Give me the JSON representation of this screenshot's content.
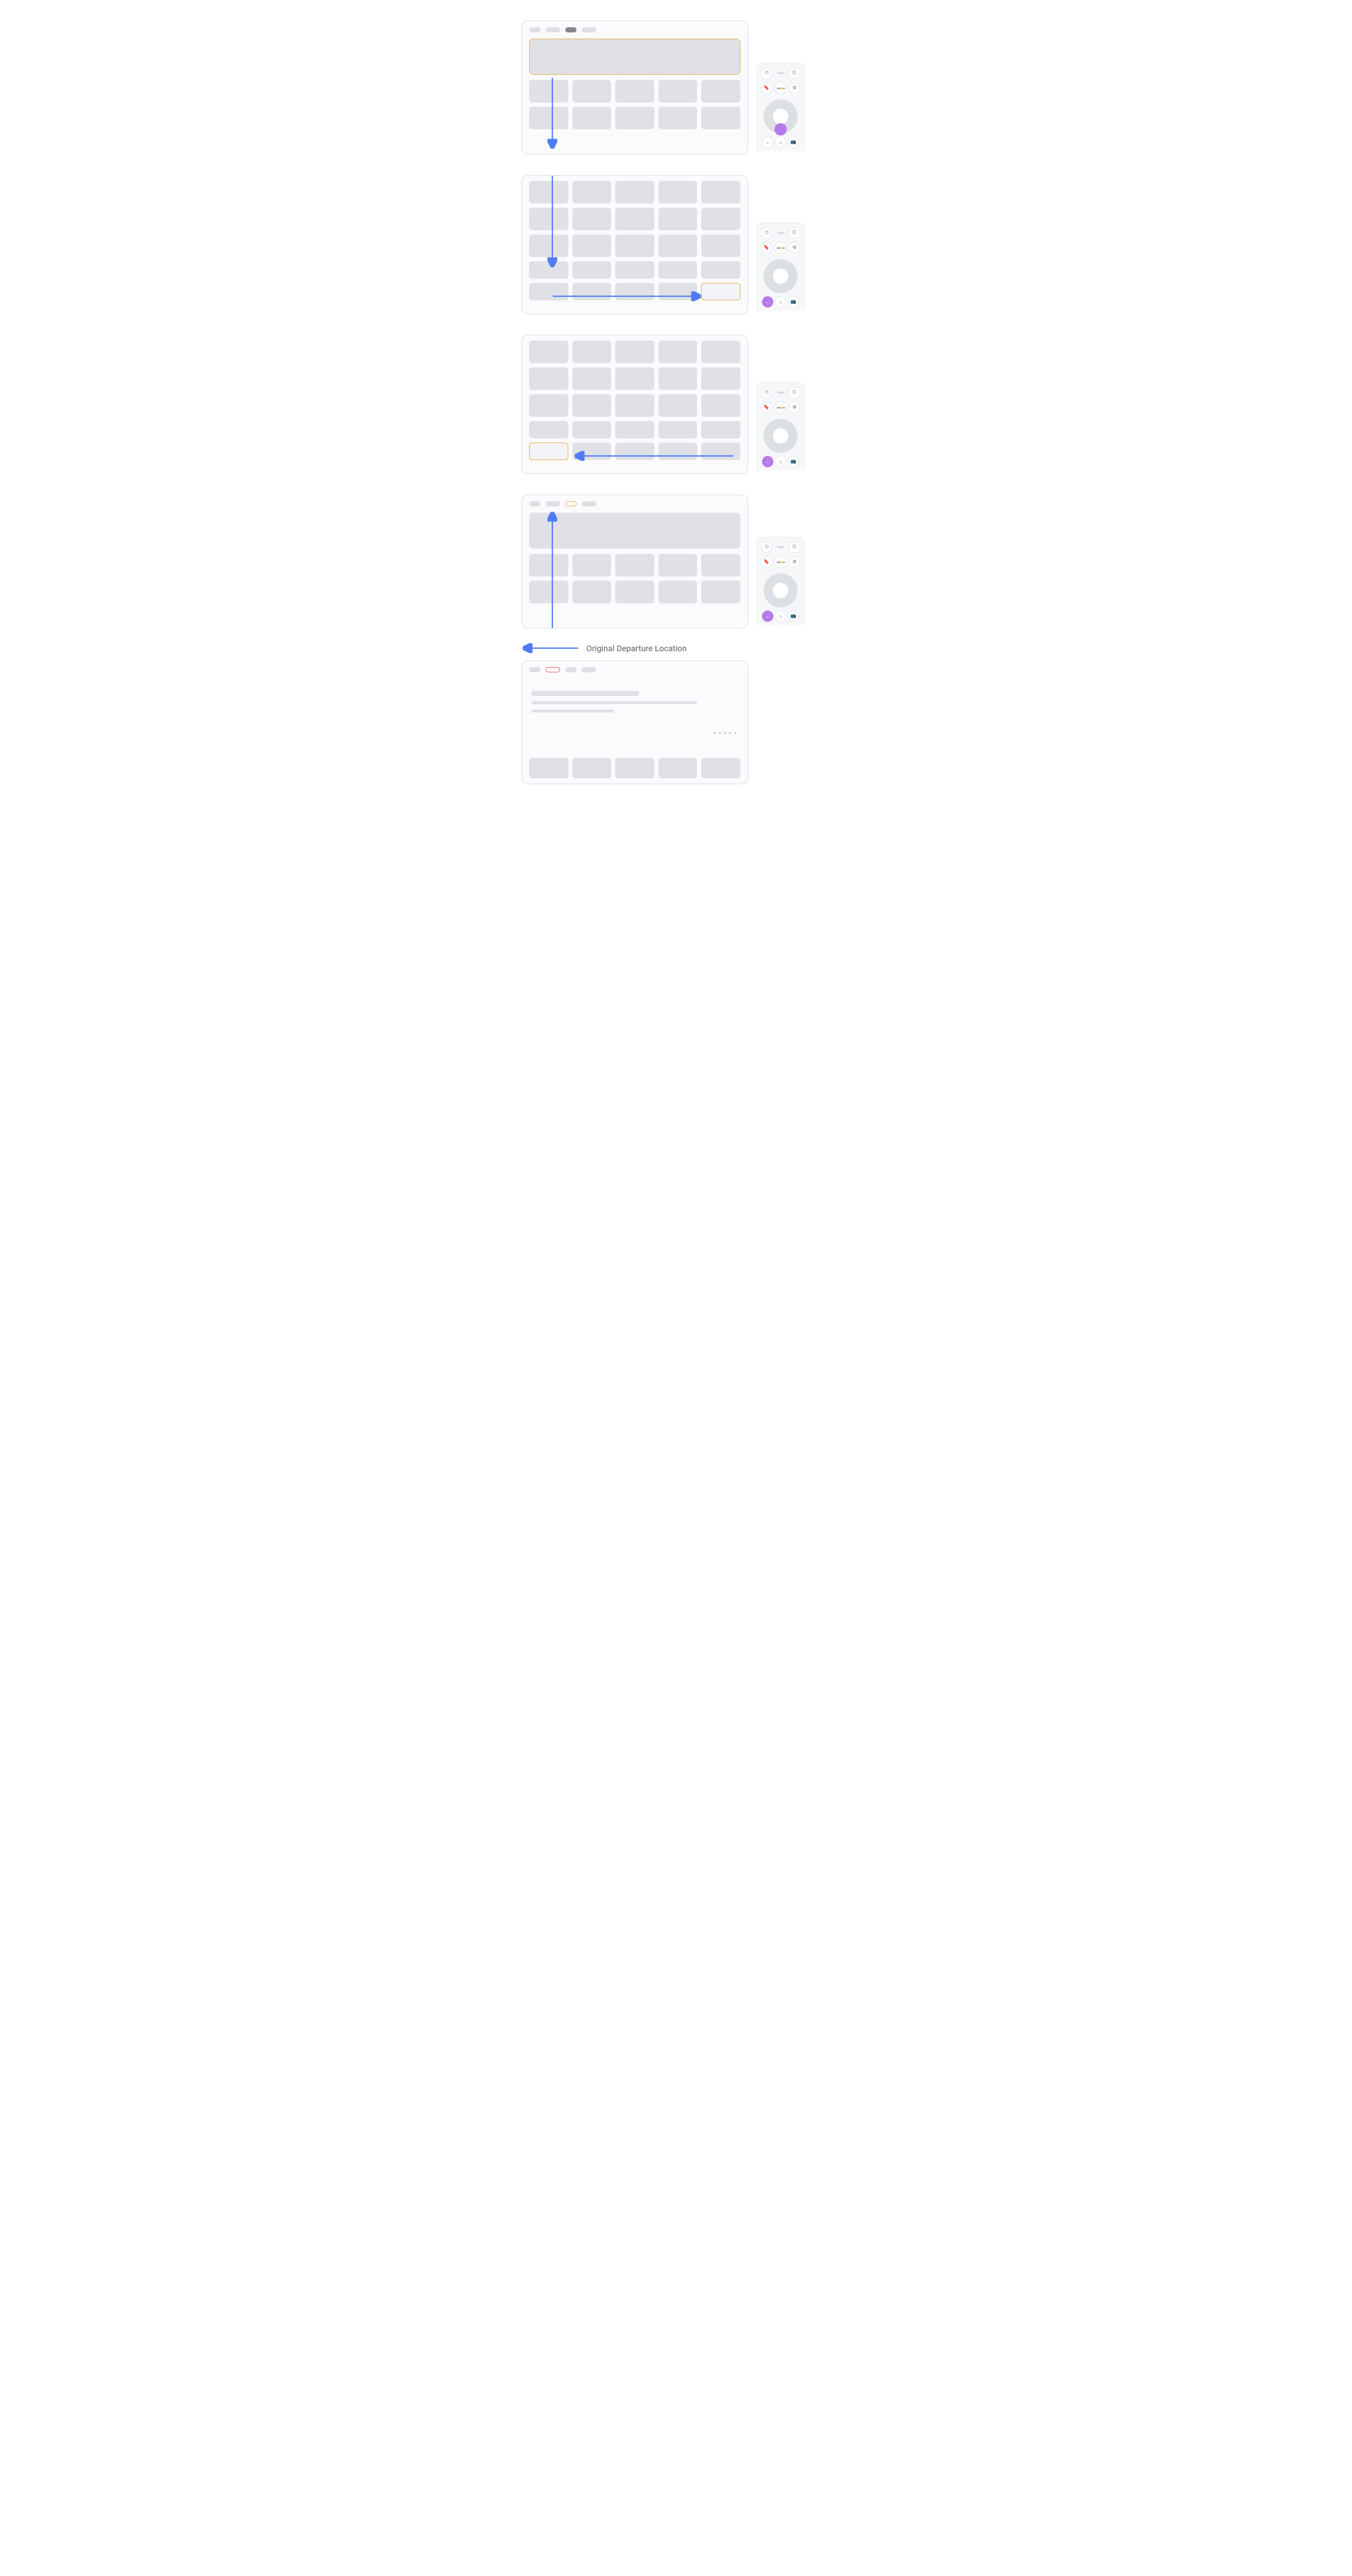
{
  "label": "Original Departure Location",
  "remote": {
    "power": "⏻",
    "input": "⎘",
    "bookmark": "🔖",
    "settings": "⚙",
    "back": "←",
    "home": "⌂",
    "tv": "📺"
  },
  "panels": {
    "p1": {
      "highlight": "dpad-down"
    },
    "p2": {
      "highlight": "back"
    },
    "p3": {
      "highlight": "back"
    },
    "p4": {
      "highlight": "back"
    }
  }
}
